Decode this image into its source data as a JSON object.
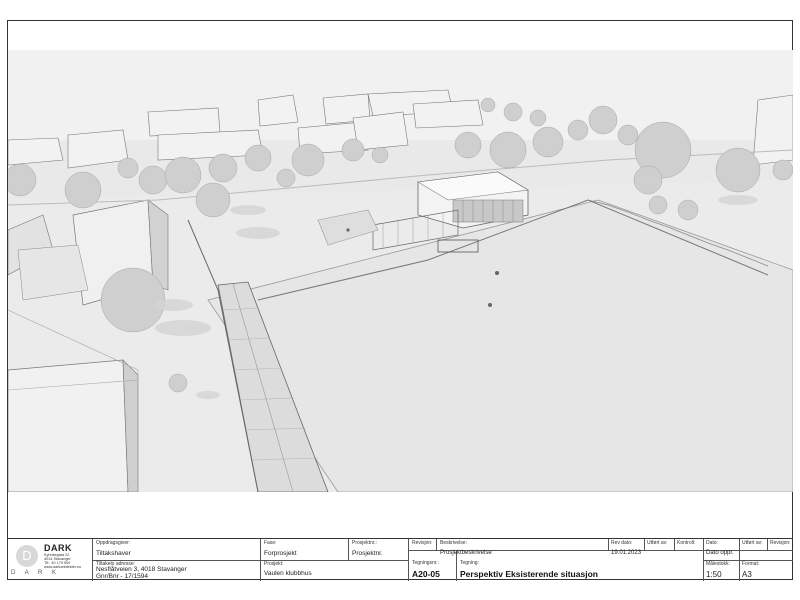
{
  "logo": {
    "name": "DARK",
    "letter": "D",
    "wordmark": "D A R K",
    "address": [
      "Kyhnkegata 22",
      "4014 Stavanger",
      "Tlf.: 40 179 500",
      "www.darkarkitekter.no"
    ]
  },
  "titleblock": {
    "oppdragsgiver": {
      "label": "Oppdragsgiver:",
      "value": "Tiltakshaver"
    },
    "tiltaksadresse": {
      "label": "Tiltakets adresse:",
      "value": "Nesflåtveien 3, 4018 Stavanger",
      "gnr": "Gnr/Bnr - 17/1594"
    },
    "fase": {
      "label": "Fase:",
      "value": "Forprosjekt"
    },
    "prosjekt": {
      "label": "Prosjekt:",
      "value": "Vaulen klubbhus"
    },
    "prosjektnr": {
      "label": "Prosjektnr.:",
      "value": "Prosjektnr."
    },
    "revisjon": {
      "label": "Revisjon:"
    },
    "beskrivelse": {
      "label": "Beskrivelse:",
      "value": "Prosjektbeskrivelse"
    },
    "rev_dato": {
      "label": "Rev dato:",
      "value": "19.01.2023"
    },
    "utfort_av": {
      "label": "Utført av:"
    },
    "kontroll": {
      "label": "Kontroll:"
    },
    "dato": {
      "label": "Dato:",
      "value": "Dato oppr."
    },
    "utfort_av2": {
      "label": "Utført av:"
    },
    "revisjon2": {
      "label": "Revisjon:"
    },
    "tegningsnr": {
      "label": "Tegningsnr.:",
      "value": "A20-05"
    },
    "tegning": {
      "label": "Tegning:",
      "value": "Perspektiv Eksisterende situasjon"
    },
    "malestokk": {
      "label": "Målestokk:",
      "value": "1:50"
    },
    "format": {
      "label": "Format:",
      "value": "A3"
    }
  }
}
